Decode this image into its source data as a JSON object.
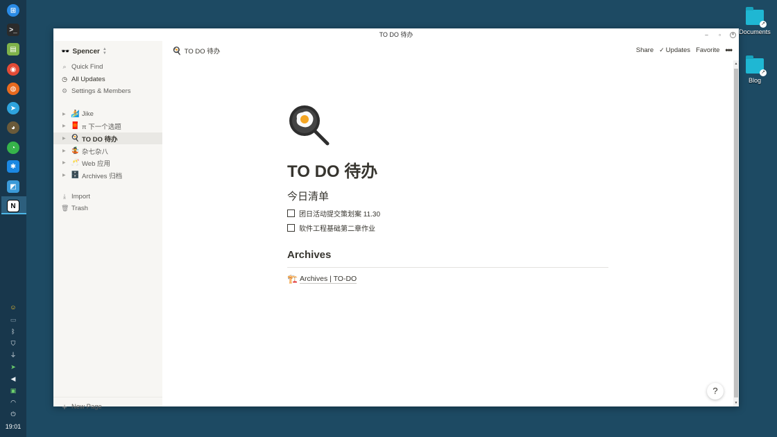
{
  "window": {
    "title": "TO DO 待办"
  },
  "sidebar": {
    "workspace": "Spencer",
    "nav": [
      {
        "label": "Quick Find",
        "icon": "search-icon"
      },
      {
        "label": "All Updates",
        "icon": "clock-icon"
      },
      {
        "label": "Settings & Members",
        "icon": "gear-icon"
      }
    ],
    "pages": [
      {
        "label": "Jike",
        "icon": "surf-icon",
        "emoji": "🏄"
      },
      {
        "label": "π 下一个选题",
        "icon": "red-envelope-icon",
        "emoji": "🧧"
      },
      {
        "label": "TO DO 待办",
        "icon": "frying-pan-icon",
        "emoji": "🍳"
      },
      {
        "label": "杂七杂八",
        "icon": "juggler-icon",
        "emoji": "🤹"
      },
      {
        "label": "Web 应用",
        "icon": "cheers-icon",
        "emoji": "🥂"
      },
      {
        "label": "Archives 归档",
        "icon": "cabinet-icon",
        "emoji": "🗄️"
      }
    ],
    "extra": [
      {
        "label": "Import",
        "icon": "download-icon"
      },
      {
        "label": "Trash",
        "icon": "trash-icon"
      }
    ],
    "new_page": "New Page"
  },
  "topbar": {
    "breadcrumb": "TO DO 待办",
    "share": "Share",
    "updates": "Updates",
    "favorite": "Favorite"
  },
  "page": {
    "title": "TO DO 待办",
    "section1": "今日清单",
    "todos": [
      "团日活动提交策划案 11.30",
      "软件工程基础第二章作业"
    ],
    "section2": "Archives",
    "link": "Archives | TO-DO",
    "link_emoji": "🏗️"
  },
  "desktop": {
    "icons": [
      "Documents",
      "Blog"
    ]
  },
  "dock": {
    "clock": "19:01"
  },
  "help": "?"
}
